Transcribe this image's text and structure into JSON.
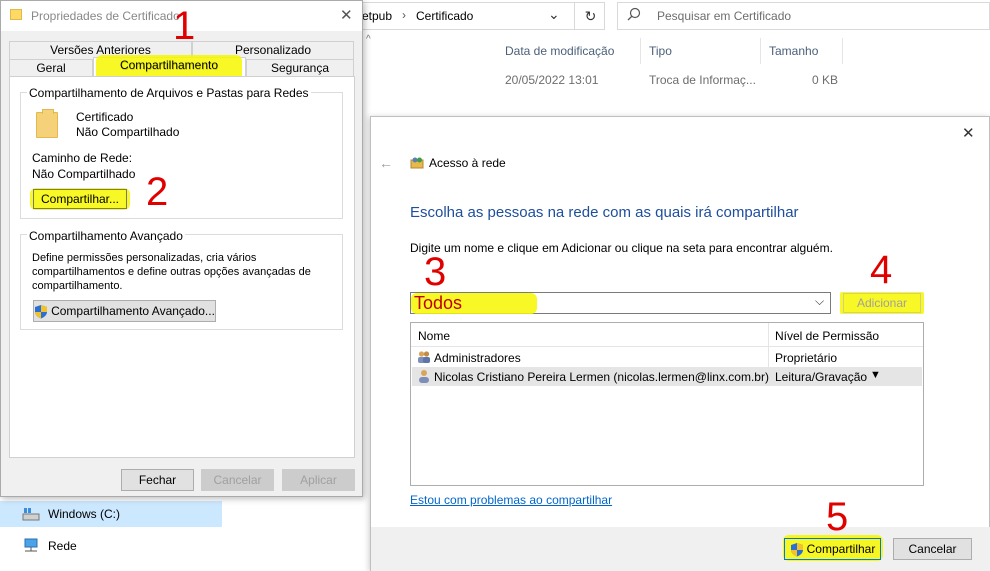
{
  "explorer": {
    "address_prefix": "etpub",
    "address_sep": "›",
    "address_folder": "Certificado",
    "search_placeholder": "Pesquisar em Certificado",
    "columns": [
      "Data de modificação",
      "Tipo",
      "Tamanho"
    ],
    "file_row": {
      "date": "20/05/2022 13:01",
      "type": "Troca de Informaç...",
      "size": "0 KB"
    },
    "nav": [
      {
        "label": "Windows (C:)",
        "icon": "drive-icon",
        "selected": true
      },
      {
        "label": "Rede",
        "icon": "network-icon",
        "selected": false
      }
    ]
  },
  "properties": {
    "title": "Propriedades de Certificado",
    "tabs_top": [
      "Versões Anteriores",
      "Personalizado"
    ],
    "tabs_bottom": [
      "Geral",
      "Compartilhamento",
      "Segurança"
    ],
    "group1_title": "Compartilhamento de Arquivos e Pastas para Redes",
    "folder_name": "Certificado",
    "folder_status": "Não Compartilhado",
    "network_path_label": "Caminho de Rede:",
    "network_path_value": "Não Compartilhado",
    "share_button": "Compartilhar...",
    "group2_title": "Compartilhamento Avançado",
    "advanced_desc": "Define permissões personalizadas, cria vários compartilhamentos e define outras opções avançadas de compartilhamento.",
    "advanced_button": "Compartilhamento Avançado...",
    "close_button": "Fechar",
    "cancel_button": "Cancelar",
    "apply_button": "Aplicar"
  },
  "share_dialog": {
    "nav_title": "Acesso à rede",
    "heading": "Escolha as pessoas na rede com as quais irá compartilhar",
    "instruction": "Digite um nome e clique em Adicionar ou clique na seta para encontrar alguém.",
    "input_value": "Todos",
    "add_button": "Adicionar",
    "columns": [
      "Nome",
      "Nível de Permissão"
    ],
    "rows": [
      {
        "name": "Administradores",
        "permission": "Proprietário",
        "selected": false
      },
      {
        "name": "Nicolas Cristiano Pereira Lermen (nicolas.lermen@linx.com.br)",
        "permission": "Leitura/Gravação",
        "selected": true
      }
    ],
    "help_link": "Estou com problemas ao compartilhar",
    "share_button": "Compartilhar",
    "cancel_button": "Cancelar"
  },
  "annotations": [
    "1",
    "2",
    "3",
    "4",
    "5"
  ],
  "colors": {
    "highlight": "#f7f700",
    "annotation": "#e00000",
    "heading_blue": "#1e4e9c",
    "link_blue": "#0066cc",
    "selection": "#cce8ff"
  }
}
